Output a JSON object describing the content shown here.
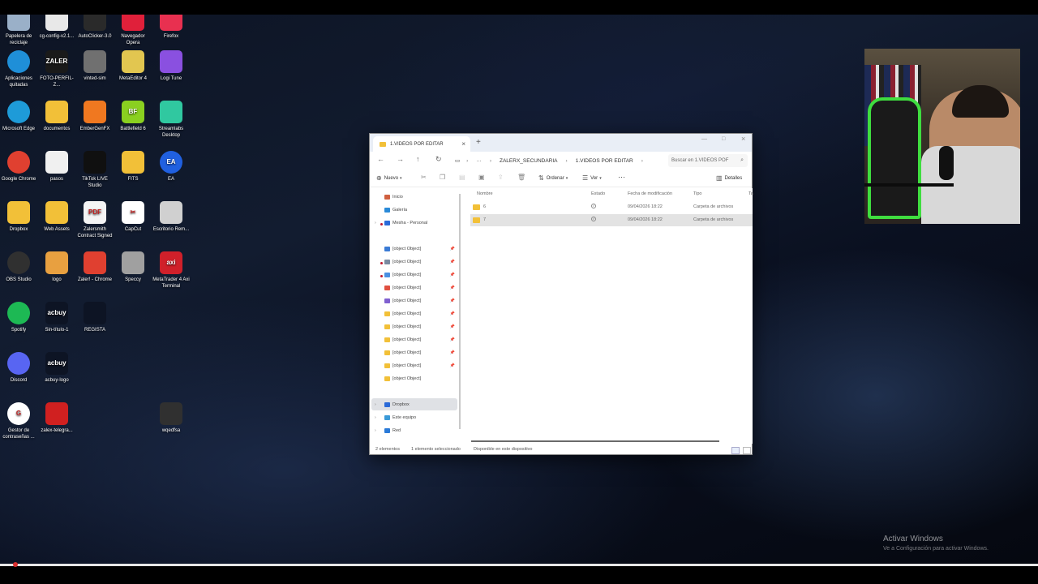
{
  "desktop_icons": [
    {
      "label": "Papelera de reciclaje",
      "color": "#9ab0c8",
      "glyph": ""
    },
    {
      "label": "cg-config-v2.1...",
      "color": "#e8e8e8",
      "glyph": ""
    },
    {
      "label": "AutoClicker-3.0",
      "color": "#2a2a2a",
      "glyph": ""
    },
    {
      "label": "Navegador Opera",
      "color": "#e0203a",
      "glyph": ""
    },
    {
      "label": "Firefox",
      "color": "#e83050",
      "glyph": ""
    },
    {
      "label": "Aplicaciones quitadas",
      "color": "#1f8fd8",
      "glyph": ""
    },
    {
      "label": "FOTO-PERFIL-Z...",
      "color": "#1a1a1a",
      "glyph": "ZALER"
    },
    {
      "label": "vinted-sim",
      "color": "#707070",
      "glyph": ""
    },
    {
      "label": "MetaEditor 4",
      "color": "#e2c650",
      "glyph": ""
    },
    {
      "label": "Logi Tune",
      "color": "#8a50e0",
      "glyph": ""
    },
    {
      "label": "Microsoft Edge",
      "color": "#1e9bd8",
      "glyph": ""
    },
    {
      "label": "documentos",
      "color": "#f2c038",
      "glyph": ""
    },
    {
      "label": "EmberGenFX",
      "color": "#f07820",
      "glyph": ""
    },
    {
      "label": "Battlefield 6",
      "color": "#8ad020",
      "glyph": "BF"
    },
    {
      "label": "Streamlabs Desktop",
      "color": "#30c8a0",
      "glyph": ""
    },
    {
      "label": "Google Chrome",
      "color": "#e04030",
      "glyph": ""
    },
    {
      "label": "pasos",
      "color": "#f0f0f0",
      "glyph": ""
    },
    {
      "label": "TikTok LIVE Studio",
      "color": "#101010",
      "glyph": ""
    },
    {
      "label": "FITS",
      "color": "#f2c038",
      "glyph": ""
    },
    {
      "label": "EA",
      "color": "#2060e0",
      "glyph": "EA"
    },
    {
      "label": "Dropbox",
      "color": "#f2c038",
      "glyph": ""
    },
    {
      "label": "Web Assets",
      "color": "#f2c038",
      "glyph": ""
    },
    {
      "label": "Zalersmith Contract Signed",
      "color": "#f4f4f4",
      "glyph": "PDF"
    },
    {
      "label": "CapCut",
      "color": "#ffffff",
      "glyph": "✂"
    },
    {
      "label": "Escritorio Rem...",
      "color": "#d0d0d0",
      "glyph": ""
    },
    {
      "label": "OBS Studio",
      "color": "#303030",
      "glyph": ""
    },
    {
      "label": "logo",
      "color": "#e8a040",
      "glyph": ""
    },
    {
      "label": "Zaler! - Chrome",
      "color": "#e04030",
      "glyph": ""
    },
    {
      "label": "Speccy",
      "color": "#a0a0a0",
      "glyph": ""
    },
    {
      "label": "MetaTrader 4 Axi Terminal",
      "color": "#d0202a",
      "glyph": "axi"
    },
    {
      "label": "Spotify",
      "color": "#1db954",
      "glyph": ""
    },
    {
      "label": "Sin-título-1",
      "color": "#0d1424",
      "glyph": "acbuy"
    },
    {
      "label": "REGISTA",
      "color": "#0d1424",
      "glyph": ""
    },
    {
      "label": "Discord",
      "color": "#5865f2",
      "glyph": ""
    },
    {
      "label": "acbuy-logo",
      "color": "#0d1424",
      "glyph": "acbuy"
    },
    {
      "label": "Gestor de contraseñas ...",
      "color": "#ffffff",
      "glyph": "G"
    },
    {
      "label": "zalex-telegra...",
      "color": "#d02020",
      "glyph": ""
    },
    {
      "label": "wqedfsa",
      "color": "#303030",
      "glyph": ""
    }
  ],
  "watermark": {
    "title": "Activar Windows",
    "subtitle": "Ve a Configuración para activar Windows."
  },
  "explorer": {
    "tab_title": "1.VIDEOS POR EDITAR",
    "new_tab": "+",
    "breadcrumb": [
      "ZALERX_SECUNDARIA",
      "1.VIDEOS POR EDITAR"
    ],
    "search_placeholder": "Buscar en 1.VIDEOS POF",
    "toolbar": {
      "new_label": "Nuevo",
      "sort_label": "Ordenar",
      "view_label": "Ver",
      "more_label": "···",
      "details_label": "Detalles"
    },
    "nav": {
      "top": [
        "Inicio",
        "Galería",
        "Mesha - Personal"
      ],
      "quick": [
        {
          "label": "Downloads",
          "color": "#3a7bd5"
        },
        {
          "label": "Documentos",
          "color": "#7a8aa0"
        },
        {
          "label": "Imágenes",
          "color": "#4a90e2"
        },
        {
          "label": "Música",
          "color": "#e05040"
        },
        {
          "label": "Vídeos",
          "color": "#8060d0"
        },
        {
          "label": "Desktop",
          "color": "#f2c038"
        },
        {
          "label": "ZALERX TIKTOK CONTENT",
          "color": "#f2c038"
        },
        {
          "label": "Dropbox",
          "color": "#f2c038"
        },
        {
          "label": "REPSBLAST",
          "color": "#f2c038"
        },
        {
          "label": "3.VIDEOS POR EDITAR",
          "color": "#f2c038"
        },
        {
          "label": "Ingresos",
          "color": "#f2c038"
        }
      ],
      "bottom": [
        "Dropbox",
        "Este equipo",
        "Red"
      ]
    },
    "columns": [
      "Nombre",
      "Estado",
      "Fecha de modificación",
      "Tipo",
      "Ta"
    ],
    "rows": [
      {
        "name": "6",
        "date": "09/04/2026 18:22",
        "type": "Carpeta de archivos"
      },
      {
        "name": "7",
        "date": "09/04/2026 18:22",
        "type": "Carpeta de archivos"
      }
    ],
    "status": {
      "count": "2 elementos",
      "selected": "1 elemento seleccionado",
      "availability": "Disponible en este dispositivo"
    }
  }
}
